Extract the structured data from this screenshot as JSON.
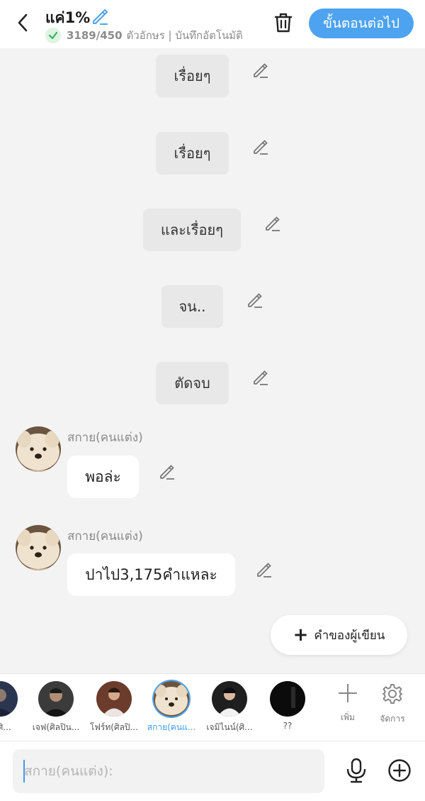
{
  "header": {
    "title": "แค่1%",
    "char_count": "3189/450",
    "char_unit_status": "ตัวอักษร | บันทึกอัตโนมัติ",
    "next_label": "ขั้นตอนต่อไป"
  },
  "messages": {
    "m1": "เรื่อยๆ",
    "m2": "เรื่อยๆ",
    "m3": "และเรื่อยๆ",
    "m4": "จน..",
    "m5": "ตัดจบ",
    "m6_author": "สกาย(คนแต่ง)",
    "m6_text": "พอล่ะ",
    "m7_author": "สกาย(คนแต่ง)",
    "m7_text": "ปาไป3,175คำแหละ"
  },
  "author_note": {
    "label": "คำของผู้เขียน"
  },
  "characters": [
    {
      "name": "ด(ศิ..."
    },
    {
      "name": "เจฟ(ศิลปิน..."
    },
    {
      "name": "โฟร์ท(ศิลปิ..."
    },
    {
      "name": "สกาย(คนแ..."
    },
    {
      "name": "เจมิไนน์(ศิ..."
    },
    {
      "name": "??"
    }
  ],
  "tools": {
    "add_label": "เพิ่ม",
    "manage_label": "จัดการ"
  },
  "input": {
    "placeholder": "สกาย(คนแต่ง):"
  },
  "colors": {
    "accent": "#4da3ef",
    "background": "#f3f3f3",
    "check_green": "#2fb75a"
  }
}
